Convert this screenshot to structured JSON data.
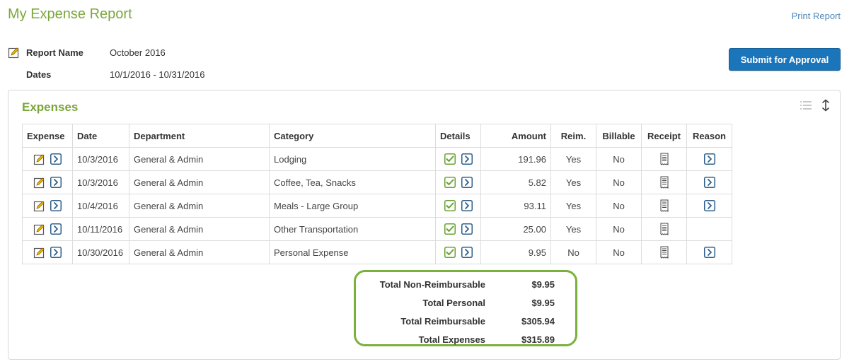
{
  "header": {
    "title": "My Expense Report",
    "print_label": "Print Report",
    "submit_label": "Submit for Approval"
  },
  "report": {
    "name_label": "Report Name",
    "name_value": "October 2016",
    "dates_label": "Dates",
    "dates_value": "10/1/2016 - 10/31/2016"
  },
  "expenses": {
    "title": "Expenses",
    "columns": [
      "Expense",
      "Date",
      "Department",
      "Category",
      "Details",
      "Amount",
      "Reim.",
      "Billable",
      "Receipt",
      "Reason"
    ],
    "rows": [
      {
        "date": "10/3/2016",
        "department": "General & Admin",
        "category": "Lodging",
        "amount": "191.96",
        "reim": "Yes",
        "billable": "No",
        "has_reason": true
      },
      {
        "date": "10/3/2016",
        "department": "General & Admin",
        "category": "Coffee, Tea, Snacks",
        "amount": "5.82",
        "reim": "Yes",
        "billable": "No",
        "has_reason": true
      },
      {
        "date": "10/4/2016",
        "department": "General & Admin",
        "category": "Meals - Large Group",
        "amount": "93.11",
        "reim": "Yes",
        "billable": "No",
        "has_reason": true
      },
      {
        "date": "10/11/2016",
        "department": "General & Admin",
        "category": "Other Transportation",
        "amount": "25.00",
        "reim": "Yes",
        "billable": "No",
        "has_reason": false
      },
      {
        "date": "10/30/2016",
        "department": "General & Admin",
        "category": "Personal Expense",
        "amount": "9.95",
        "reim": "No",
        "billable": "No",
        "has_reason": true
      }
    ]
  },
  "totals": {
    "non_reimbursable_label": "Total Non-Reimbursable",
    "non_reimbursable_value": "$9.95",
    "personal_label": "Total Personal",
    "personal_value": "$9.95",
    "reimbursable_label": "Total Reimbursable",
    "reimbursable_value": "$305.94",
    "expenses_label": "Total Expenses",
    "expenses_value": "$315.89"
  },
  "icons": {
    "edit": "edit-icon",
    "arrow": "arrow-right-icon",
    "check": "checkbox-checked-icon",
    "receipt": "receipt-icon",
    "list": "list-view-icon",
    "sort": "sort-icon"
  },
  "colors": {
    "accent_green": "#7aa73b",
    "button_blue": "#1b75bb",
    "link_blue": "#4f86b8",
    "highlight_border": "#7ab03c"
  }
}
